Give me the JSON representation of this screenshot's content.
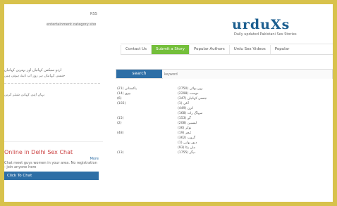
{
  "top": {
    "link": "RSS",
    "description": "entertainment category stories"
  },
  "brand": {
    "logo": "urduXs",
    "tagline": "Daily updated Pakistani Sex Stories"
  },
  "nav": {
    "items": [
      {
        "label": "Contact Us",
        "active": false
      },
      {
        "label": "Submit a Story",
        "active": true
      },
      {
        "label": "Popular Authors",
        "active": false
      },
      {
        "label": "Urdu Sex Videos",
        "active": false
      },
      {
        "label": "Popular",
        "active": false
      }
    ]
  },
  "search": {
    "button": "search",
    "placeholder": "keyword"
  },
  "categories": [
    {
      "a": "(21) پاکستانی",
      "b": "(2750) بہن بھائی",
      "c": ""
    },
    {
      "a": "(14) بیوی",
      "b": "(2298) دوست",
      "c": ""
    },
    {
      "a": "(6)",
      "b": "(347) جنسی کہانیاں",
      "c": ""
    },
    {
      "a": "(102)",
      "b": "(1) آنٹی",
      "c": ""
    },
    {
      "a": "",
      "b": "(449) کزن",
      "c": ""
    },
    {
      "a": "",
      "b": "(168) سہاگ رات",
      "c": ""
    },
    {
      "a": "(15)",
      "b": "(153) گے",
      "c": ""
    },
    {
      "a": "(2)",
      "b": "(208) لیسبین",
      "c": ""
    },
    {
      "a": "",
      "b": "(36) نوکر",
      "c": ""
    },
    {
      "a": "(48)",
      "b": "(19) ٹیچر",
      "c": ""
    },
    {
      "a": "",
      "b": "(362) گروپ",
      "c": ""
    },
    {
      "a": "",
      "b": "(1) دیور بھابی",
      "c": ""
    },
    {
      "a": "",
      "b": "(93) ماں بیٹا",
      "c": ""
    },
    {
      "a": "(13)",
      "b": "(1755) دیگر",
      "c": ""
    }
  ],
  "side": {
    "lines": [
      "اردو سیکس کہانیاں اور بہترین کہانیاں",
      "جنسی کہانیاں ہر روز اپ ڈیٹ ہوتی ہیں",
      "یہاں اپنی کہانی شیئر کریں"
    ]
  },
  "ad": {
    "title": "Online in Delhi Sex Chat",
    "more": "More",
    "body": "Chat meet guys women in your area. No registration - join anyone here",
    "button": "Click To Chat"
  }
}
